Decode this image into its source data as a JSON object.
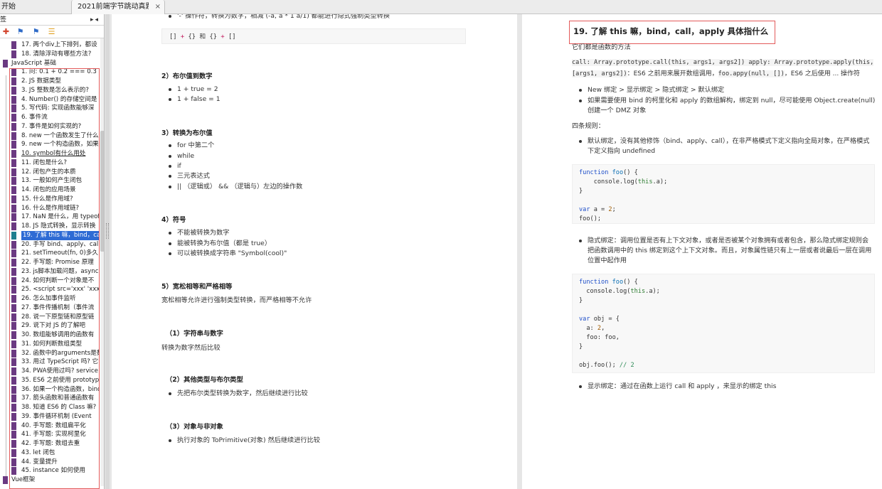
{
  "tabs": {
    "start_label": "开始",
    "doc_label": "2021前端字节跳动真题...",
    "close_glyph": "×"
  },
  "sidebar": {
    "header_label": "签",
    "header_controls": "▸◂",
    "tool_icons": [
      "bookmark-add-icon",
      "bookmark-next-icon",
      "bookmark-prev-icon",
      "bookmark-list-icon"
    ],
    "items": [
      {
        "label": "17. 两个div上下排列，都设",
        "level": 1
      },
      {
        "label": "18. 清除浮动有哪些方法?",
        "level": 1
      },
      {
        "label": "JavaScript 基础",
        "level": 0
      },
      {
        "label": "1. 问: 0.1 + 0.2 === 0.3",
        "level": 1
      },
      {
        "label": "2. JS 数据类型",
        "level": 1
      },
      {
        "label": "3. JS 整数是怎么表示的?",
        "level": 1
      },
      {
        "label": "4. Number() 的存储空间是",
        "level": 1
      },
      {
        "label": "5. 写代码: 实现函数能够深",
        "level": 1
      },
      {
        "label": "6. 事件流",
        "level": 1
      },
      {
        "label": "7. 事件是如何实现的?",
        "level": 1
      },
      {
        "label": "8. new 一个函数发生了什么",
        "level": 1
      },
      {
        "label": "9. new 一个构造函数，如果",
        "level": 1
      },
      {
        "label": "10. symbol有什么用处",
        "level": 1
      },
      {
        "label": "11. 闭包是什么?",
        "level": 1
      },
      {
        "label": "12. 闭包产生的本质",
        "level": 1
      },
      {
        "label": "13. 一般如何产生闭包",
        "level": 1
      },
      {
        "label": "14. 闭包的应用场景",
        "level": 1
      },
      {
        "label": "15. 什么是作用域?",
        "level": 1
      },
      {
        "label": "16. 什么是作用域链?",
        "level": 1
      },
      {
        "label": "17. NaN 是什么，用 typeof",
        "level": 1
      },
      {
        "label": "18. JS 隐式转换，显示转换",
        "level": 1
      },
      {
        "label": "19. 了解 this 嘛，bind，call",
        "level": 1
      },
      {
        "label": "20. 手写 bind、apply、call",
        "level": 1
      },
      {
        "label": "21. setTimeout(fn, 0)多久",
        "level": 1
      },
      {
        "label": "22. 手写题: Promise 原理",
        "level": 1
      },
      {
        "label": "23. js脚本加载问题，async",
        "level": 1
      },
      {
        "label": "24. 如何判断一个对象是不",
        "level": 1
      },
      {
        "label": "25. <script src='xxx' 'xxx'/>",
        "level": 1
      },
      {
        "label": "26. 怎么加事件监听",
        "level": 1
      },
      {
        "label": "27. 事件传播机制（事件流",
        "level": 1
      },
      {
        "label": "28. 说一下原型链和原型链",
        "level": 1
      },
      {
        "label": "29. 说下对 JS 的了解吧",
        "level": 1
      },
      {
        "label": "30. 数组能够调用的函数有",
        "level": 1
      },
      {
        "label": "31. 如何判断数组类型",
        "level": 1
      },
      {
        "label": "32. 函数中的arguments是数",
        "level": 1
      },
      {
        "label": "33. 用过 TypeScript 吗? 它",
        "level": 1
      },
      {
        "label": "34. PWA使用过吗? service",
        "level": 1
      },
      {
        "label": "35. ES6 之前使用 prototype",
        "level": 1
      },
      {
        "label": "36. 如果一个构造函数，bind",
        "level": 1
      },
      {
        "label": "37. 箭头函数和普通函数有",
        "level": 1
      },
      {
        "label": "38. 知道 ES6 的 Class 嘛?",
        "level": 1
      },
      {
        "label": "39. 事件循环机制 (Event",
        "level": 1
      },
      {
        "label": "40. 手写题: 数组扁平化",
        "level": 1
      },
      {
        "label": "41. 手写题: 实现柯里化",
        "level": 1
      },
      {
        "label": "42. 手写题: 数组去重",
        "level": 1
      },
      {
        "label": "43. let 闭包",
        "level": 1
      },
      {
        "label": "44. 变量提升",
        "level": 1
      },
      {
        "label": "45. instance 如何使用",
        "level": 1
      },
      {
        "label": "Vue框架",
        "level": 0
      }
    ],
    "selected_index": 21,
    "underlined_index": 12
  },
  "left_page": {
    "top_bullet": "'-' 操作符，转换为数字，相减 (-a, a * 1 a/1) 都能进行隐式强制类型转换",
    "code_inline": {
      "a": "[]",
      "plus1": "+",
      "b": "{}",
      "and": "和",
      "c": "{}",
      "plus2": "+",
      "d": "[]"
    },
    "s2_title": "2）布尔值到数字",
    "s2_items": [
      "1 + true = 2",
      "1 + false = 1"
    ],
    "s3_title": "3）转换为布尔值",
    "s3_items": [
      "for 中第二个",
      "while",
      "if",
      "三元表达式",
      "||  （逻辑或） &&  （逻辑与）左边的操作数"
    ],
    "s4_title": "4）符号",
    "s4_items": [
      "不能被转换为数字",
      "能被转换为布尔值（都是 true）",
      "可以被转换成字符串 \"Symbol(cool)\""
    ],
    "s5_title": "5）宽松相等和严格相等",
    "s5_text": "宽松相等允许进行强制类型转换，而严格相等不允许",
    "ss1_title": "（1）字符串与数字",
    "ss1_text": "转换为数字然后比较",
    "ss2_title": "（2）其他类型与布尔类型",
    "ss2_item": "先把布尔类型转换为数字，然后继续进行比较",
    "ss3_title": "（3）对象与非对象",
    "ss3_item": "执行对象的 ToPrimitive(对象) 然后继续进行比较"
  },
  "right_page": {
    "title": "19. 了解 this 嘛，bind，call，apply 具体指什么",
    "intro": "它们都是函数的方法",
    "sig_line1_code": "call: Array.prototype.call(this, args1, args2]) apply: Array.prototype.apply(this,",
    "sig_line2_code_a": "[args1, args2])",
    "sig_line2_text": "：ES6 之前用来展开数组调用，",
    "sig_line2_code_b": "foo.appy(null, [])",
    "sig_line2_tail": "，ES6 之后使用 ... 操作符",
    "b1": "New 绑定 > 显示绑定 > 隐式绑定 > 默认绑定",
    "b2_line1": "如果需要使用 bind 的柯里化和 apply 的数组解构，绑定到 null，尽可能使用 Object.create(null)",
    "b2_line2": "创建一个 DMZ 对象",
    "rules_title": "四条规则：",
    "rule1_line1": "默认绑定，没有其他修饰（bind、apply、call），在非严格模式下定义指向全局对象，在严格模式",
    "rule1_line2": "下定义指向 undefined",
    "code1": {
      "l1_kw": "function",
      "l1_fn": "foo",
      "l1_rest": "() {",
      "l2_a": "console.log(",
      "l2_this": "this",
      "l2_b": ".a);",
      "l3": "}",
      "l5_kw": "var",
      "l5_a": " a = ",
      "l5_num": "2",
      "l5_end": ";",
      "l6": "foo();"
    },
    "rule2_line1": "隐式绑定：调用位置是否有上下文对象，或者是否被某个对象拥有或者包含，那么隐式绑定规则会",
    "rule2_line2": "把函数调用中的 this 绑定到这个上下文对象。而且，对象属性链只有上一层或者说最后一层在调用",
    "rule2_line3": "位置中起作用",
    "code2": {
      "l1_kw": "function",
      "l1_fn": "foo",
      "l1_rest": "() {",
      "l2_a": "console.log(",
      "l2_this": "this",
      "l2_b": ".a);",
      "l3": "}",
      "l5_kw": "var",
      "l5_a": " obj = {",
      "l6_a": "a: ",
      "l6_num": "2",
      "l6_end": ",",
      "l7": "foo: foo,",
      "l8": "}",
      "l10_a": "obj.foo(); ",
      "l10_cm": "// 2"
    },
    "rule3": "显示绑定：通过在函数上运行 call 和 apply ，来显示的绑定 this"
  }
}
